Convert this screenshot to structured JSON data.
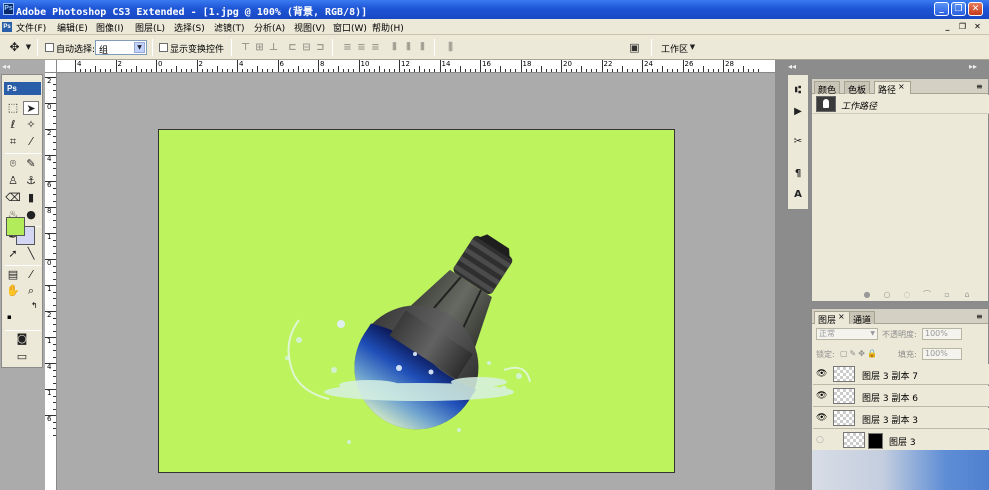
{
  "window": {
    "title": "Adobe Photoshop CS3 Extended - [1.jpg @ 100% (背景, RGB/8)]",
    "app_icon": "Ps",
    "controls": [
      "_",
      "❐",
      "✕"
    ],
    "mdi_controls": [
      "_",
      "❐",
      "✕"
    ]
  },
  "menu": {
    "items": [
      "文件(F)",
      "编辑(E)",
      "图像(I)",
      "图层(L)",
      "选择(S)",
      "滤镜(T)",
      "分析(A)",
      "视图(V)",
      "窗口(W)",
      "帮助(H)"
    ]
  },
  "options": {
    "auto_select_label": "自动选择:",
    "auto_select_value": "组",
    "show_transform_label": "显示变换控件",
    "workspace_label": "工作区"
  },
  "ruler": {
    "top_labels": [
      "4",
      "2",
      "0",
      "2",
      "4",
      "6",
      "8",
      "10",
      "12",
      "14",
      "16",
      "18",
      "20",
      "22",
      "24",
      "26",
      "28"
    ],
    "left_labels": [
      "2",
      "0",
      "2",
      "4",
      "6",
      "8",
      "1",
      "0",
      "1",
      "2",
      "1",
      "4",
      "1",
      "6"
    ]
  },
  "toolbox": {
    "logo": "Ps",
    "colors": {
      "foreground": "#b3ec5a",
      "background": "#d3d7f4"
    }
  },
  "document": {
    "background_color": "#bdf35c"
  },
  "panels": {
    "top": {
      "tabs": [
        "颜色",
        "色板",
        "路径"
      ],
      "active_tab": "路径",
      "path_item": "工作路径"
    },
    "layers": {
      "tabs": [
        "图层",
        "通道"
      ],
      "active_tab": "图层",
      "blend_mode": "正常",
      "opacity_label": "不透明度:",
      "opacity_value": "100%",
      "lock_label": "锁定:",
      "fill_label": "填充:",
      "fill_value": "100%",
      "items": [
        {
          "name": "图层 3 副本 7"
        },
        {
          "name": "图层 3 副本 6"
        },
        {
          "name": "图层 3 副本 3"
        },
        {
          "name": "图层 3"
        }
      ]
    }
  }
}
